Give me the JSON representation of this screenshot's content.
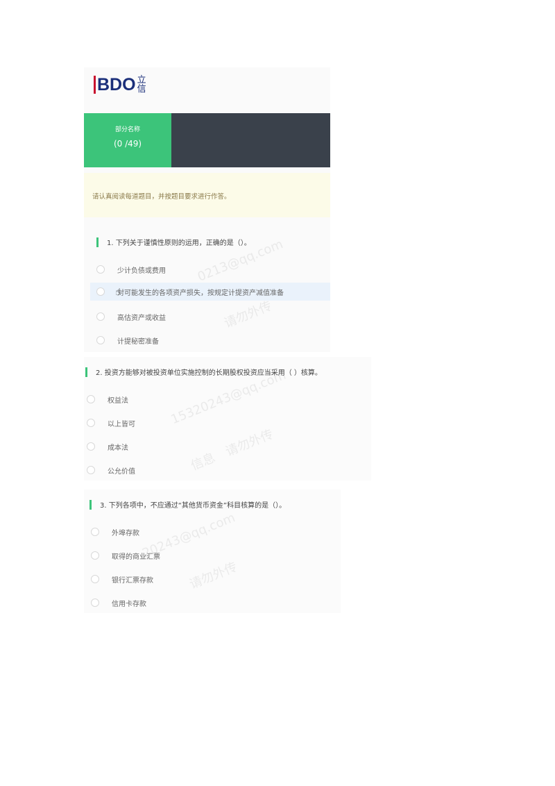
{
  "logo": {
    "brand": "BDO",
    "cn_text": "立信"
  },
  "nav": {
    "section_name": "部分名称",
    "progress": "(0 /49)"
  },
  "notice": "请认真阅读每道题目，并按题目要求进行作答。",
  "questions": [
    {
      "title": "1.  下列关于谨慎性原则的运用，正确的是（）。",
      "options": [
        "少计负债或费用",
        "对可能发生的各项资产损失，按规定计提资产减值准备",
        "高估资产或收益",
        "计提秘密准备"
      ],
      "hovered_index": 1
    },
    {
      "title": "2.  投资方能够对被投资单位实施控制的长期股权投资应当采用（ ）核算。",
      "options": [
        "权益法",
        "以上皆可",
        "成本法",
        "公允价值"
      ]
    },
    {
      "title": "3.  下列各项中，不应通过“其他货币资金”科目核算的是（）。",
      "options": [
        "外埠存款",
        "取得的商业汇票",
        "银行汇票存款",
        "信用卡存款"
      ]
    }
  ],
  "colors": {
    "accent": "#3cc47a",
    "nav_bg": "#3a414b",
    "notice_bg": "#fcfbe8",
    "highlight": "#eaf2fb"
  }
}
